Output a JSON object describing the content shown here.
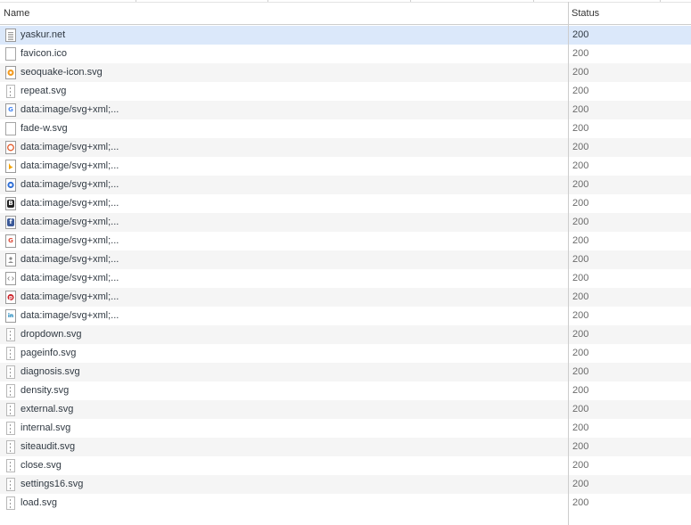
{
  "columns": {
    "name": "Name",
    "status": "Status"
  },
  "rows": [
    {
      "name": "yaskur.net",
      "status": "200",
      "icon": "document-icon"
    },
    {
      "name": "favicon.ico",
      "status": "200",
      "icon": "blank-file-icon"
    },
    {
      "name": "seoquake-icon.svg",
      "status": "200",
      "icon": "seoquake-icon"
    },
    {
      "name": "repeat.svg",
      "status": "200",
      "icon": "svg-file-icon"
    },
    {
      "name": "data:image/svg+xml;...",
      "status": "200",
      "icon": "google-icon"
    },
    {
      "name": "fade-w.svg",
      "status": "200",
      "icon": "blank-file-icon"
    },
    {
      "name": "data:image/svg+xml;...",
      "status": "200",
      "icon": "circle-icon"
    },
    {
      "name": "data:image/svg+xml;...",
      "status": "200",
      "icon": "bing-icon"
    },
    {
      "name": "data:image/svg+xml;...",
      "status": "200",
      "icon": "globe-icon"
    },
    {
      "name": "data:image/svg+xml;...",
      "status": "200",
      "icon": "bookmark-icon"
    },
    {
      "name": "data:image/svg+xml;...",
      "status": "200",
      "icon": "facebook-icon"
    },
    {
      "name": "data:image/svg+xml;...",
      "status": "200",
      "icon": "google-plus-icon"
    },
    {
      "name": "data:image/svg+xml;...",
      "status": "200",
      "icon": "user-icon"
    },
    {
      "name": "data:image/svg+xml;...",
      "status": "200",
      "icon": "code-icon"
    },
    {
      "name": "data:image/svg+xml;...",
      "status": "200",
      "icon": "pinterest-icon"
    },
    {
      "name": "data:image/svg+xml;...",
      "status": "200",
      "icon": "linkedin-icon"
    },
    {
      "name": "dropdown.svg",
      "status": "200",
      "icon": "svg-file-icon"
    },
    {
      "name": "pageinfo.svg",
      "status": "200",
      "icon": "svg-file-icon"
    },
    {
      "name": "diagnosis.svg",
      "status": "200",
      "icon": "svg-file-icon"
    },
    {
      "name": "density.svg",
      "status": "200",
      "icon": "svg-file-icon"
    },
    {
      "name": "external.svg",
      "status": "200",
      "icon": "svg-file-icon"
    },
    {
      "name": "internal.svg",
      "status": "200",
      "icon": "svg-file-icon"
    },
    {
      "name": "siteaudit.svg",
      "status": "200",
      "icon": "svg-file-icon"
    },
    {
      "name": "close.svg",
      "status": "200",
      "icon": "svg-file-icon"
    },
    {
      "name": "settings16.svg",
      "status": "200",
      "icon": "svg-file-icon"
    },
    {
      "name": "load.svg",
      "status": "200",
      "icon": "svg-file-icon"
    }
  ],
  "colors": {
    "selected_row": "#dbe8fa",
    "stripe_row": "#f5f5f5",
    "google": "#4285f4",
    "bing": "#f4a300",
    "facebook": "#3b5998",
    "google_plus": "#dd4b39",
    "pinterest": "#cb2027",
    "linkedin": "#0077b5",
    "seoquake": "#f29a1f"
  }
}
